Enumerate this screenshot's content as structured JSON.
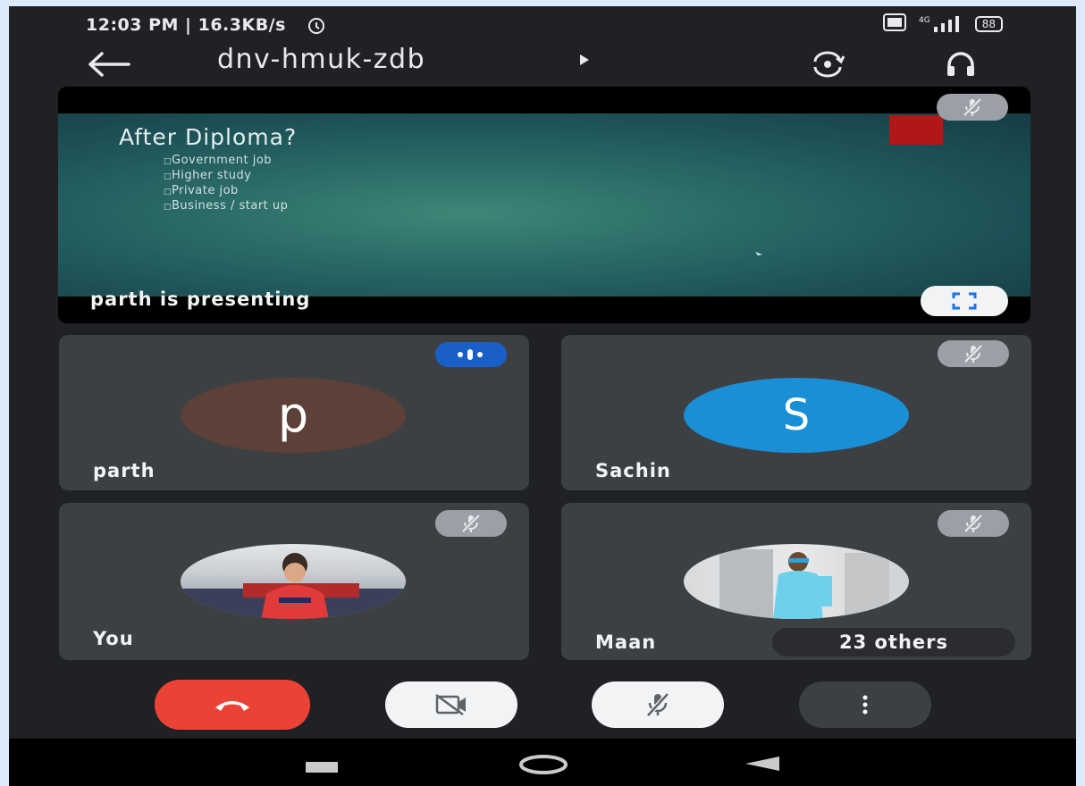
{
  "status_bar": {
    "time_speed": "12:03 PM | 16.3KB/s",
    "network": "4G",
    "battery": "88"
  },
  "header": {
    "meeting_code": "dnv-hmuk-zdb",
    "icons": [
      "back-arrow-icon",
      "expand-arrow-icon",
      "switch-camera-icon",
      "audio-output-icon"
    ]
  },
  "presentation": {
    "slide_title": "After Diploma?",
    "slide_items": [
      "Government job",
      "Higher study",
      "Private job",
      "Business / start up"
    ],
    "label": "parth is presenting"
  },
  "participants": [
    {
      "name": "parth",
      "initial": "p",
      "avatar_color": "#5d4037",
      "status": "speaking"
    },
    {
      "name": "Sachin",
      "initial": "S",
      "avatar_color": "#1a8fd6",
      "status": "muted"
    },
    {
      "name": "You",
      "initial": "",
      "avatar_color": "#c0c4c8",
      "status": "muted"
    },
    {
      "name": "Maan",
      "initial": "",
      "avatar_color": "#cfd2d4",
      "status": "muted"
    }
  ],
  "others_label": "23 others",
  "controls": [
    "end-call",
    "camera-off",
    "mic-off",
    "more-options"
  ],
  "colors": {
    "end_call": "#ea4335",
    "speaking_badge": "#1a5fc7",
    "tile_bg": "#3c4043",
    "background": "#202124"
  }
}
